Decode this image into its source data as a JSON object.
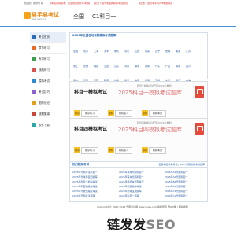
{
  "topbar": {
    "welcome": "欢迎您！先登录 吧",
    "links": [
      "【考试通用版本，最全免费的历年考题】",
      "【点击下载驾考最新模拟考试题目】",
      "【点击下载驾考手机APP刷题吧】"
    ]
  },
  "header": {
    "logo_text": "易手易考试",
    "logo_url": "www.yyws.com",
    "region": "全国",
    "subject": "C1科目一"
  },
  "sidebar": {
    "items": [
      {
        "label": "考试首页",
        "color": "#2d6db5"
      },
      {
        "label": "章节练习",
        "color": "#e66c2c"
      },
      {
        "label": "专项练习",
        "color": "#3b9e4f"
      },
      {
        "label": "随机练习",
        "color": "#d9534f"
      },
      {
        "label": "模拟考试",
        "color": "#2d8bd6"
      },
      {
        "label": "考试技巧",
        "color": "#8e63c9"
      },
      {
        "label": "图标速记",
        "color": "#e0a01a"
      },
      {
        "label": "错题集锦",
        "color": "#c9473a"
      },
      {
        "label": "软件下载",
        "color": "#2aa6a6"
      }
    ]
  },
  "region_box": {
    "title": "2025年全国各地驾照模拟考试题库",
    "provinces": [
      "全国",
      "北京",
      "上海",
      "天津",
      "重庆",
      "河北",
      "山西",
      "内蒙",
      "辽宁",
      "吉林",
      "黑龙",
      "江苏",
      "浙江",
      "安徽",
      "福建",
      "江西",
      "山东",
      "河南",
      "湖北",
      "湖南",
      "广东",
      "广西",
      "海南",
      "四川",
      "贵州",
      "云南",
      "西藏",
      "陕西",
      "甘肃",
      "青海",
      "宁夏",
      "新疆",
      "深圳",
      "大连",
      "青岛",
      "宁波",
      "厦门",
      "沈阳",
      "长春",
      "哈尔",
      "南京",
      "杭州",
      "济南",
      "武汉",
      "广州",
      "成都",
      "西安",
      "郑州",
      "长沙",
      "昆明",
      "南宁",
      "福州",
      "南昌",
      "合肥",
      "石家",
      "太原",
      "兰州",
      "银川",
      "西宁",
      "乌鲁"
    ]
  },
  "cards": [
    {
      "title": "科目一模拟考试",
      "subtitle": "科目一模拟考试已有3772人参加",
      "promo": "2025科目一模拟考试题库",
      "buttons": [
        {
          "tag": "顺序",
          "label": "顺序练习"
        },
        {
          "tag": "随机",
          "label": "随机练习"
        },
        {
          "tag": "模拟",
          "label": "模拟考试"
        }
      ]
    },
    {
      "title": "科目四模拟考试",
      "subtitle": "科目四模拟考试已有3772人参加",
      "promo": "2025科目四模拟考试题库",
      "buttons": [
        {
          "tag": "顺序",
          "label": "顺序练习"
        },
        {
          "tag": "随机",
          "label": "随机练习"
        },
        {
          "tag": "模拟",
          "label": "模拟考试"
        }
      ]
    }
  ],
  "popular": {
    "title": "热门模拟考试",
    "more": "更多地区模拟考试 | 2025驾照模拟考试题库",
    "columns": [
      [
        "2025年驾照考试科目一",
        "2025年驾考科目四题库",
        "2025年科目一模拟考试",
        "2025年科目四模拟考试",
        "2025年驾驶员理论考试",
        "2025年驾照考试题库"
      ],
      [
        "2025年货车驾照科目一",
        "2025年客车驾照科目一",
        "2025年摩托车驾照考试",
        "2025年驾照模拟考试",
        "2025年驾考宝典题库",
        "2025年科目一题库"
      ],
      [
        "2025年A1驾照科目一",
        "2025年A2驾照科目一",
        "2025年B1驾照科目一",
        "2025年B2驾照科目一",
        "2025年C1驾照科目一",
        "2025年C2驾照科目一"
      ]
    ]
  },
  "footer": {
    "copyright": "Copyright © 2007-2018 驾照考试网 www.yyws.com 版权所有 豫ICP备 | 网站地图"
  },
  "watermark": {
    "main": "链发发",
    "seo": "SEO"
  }
}
